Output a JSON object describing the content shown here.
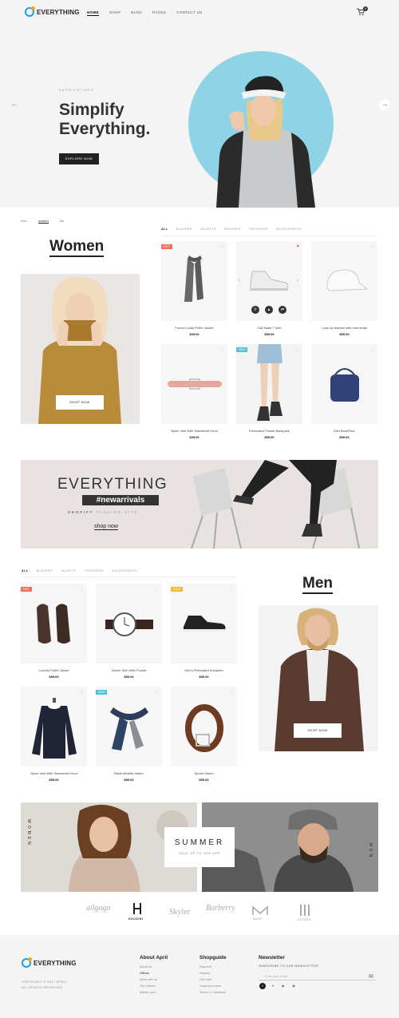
{
  "header": {
    "logo": "EVERYTHING",
    "nav": [
      "HOME",
      "SHOP",
      "BLOG",
      "PAGES",
      "CONTACT US"
    ],
    "cart_count": "0"
  },
  "hero": {
    "tag": "#APRILSTORE",
    "title_line1": "Simplify",
    "title_line2": "Everything.",
    "button": "EXPLORE NOW",
    "categories": [
      "men",
      "women",
      "kid"
    ]
  },
  "women": {
    "title": "Women",
    "shop_button": "SHOP NOW",
    "tabs": [
      "ALL",
      "BLAZERS",
      "JACKETS",
      "DRESSES",
      "TROUSERS",
      "ACCESSORIES"
    ],
    "products": [
      {
        "name": "Funnel Collar Puffer Jacket",
        "price": "$39.00",
        "badge": "HOT"
      },
      {
        "name": "Cali Skate T shirt",
        "price": "$59.00",
        "badge": ""
      },
      {
        "name": "Lace-up trainers with heel detail",
        "price": "$59.00",
        "badge": ""
      },
      {
        "name": "Nylon Vest With Sweatshirt Hood",
        "price": "$39.00",
        "badge": ""
      },
      {
        "name": "Embossed Pocket Backpack",
        "price": "$59.00",
        "badge": "NEW"
      },
      {
        "name": "Mini BackPack",
        "price": "$59.00",
        "badge": ""
      }
    ]
  },
  "banner": {
    "title": "EVERYTHING",
    "tag": "#newarrivals",
    "sub_bold": "SHOPIFY",
    "sub": "FASHION SITE",
    "link": "shop now"
  },
  "men": {
    "title": "Men",
    "shop_button": "SHOP NOW",
    "tabs": [
      "ALL",
      "BLAZERS",
      "JACKETS",
      "TROUSERS",
      "ACCESSORIES"
    ],
    "products": [
      {
        "name": "Colorful Puffer Jacket",
        "price": "$59.00",
        "badge": "HOT"
      },
      {
        "name": "Denim Shirt With Pocket",
        "price": "$59.00",
        "badge": ""
      },
      {
        "name": "Men's Perforated Sneakers",
        "price": "$59.00",
        "badge": "SALE"
      },
      {
        "name": "Nylon Vest With Sweatshirt Hood",
        "price": "$59.00",
        "badge": ""
      },
      {
        "name": "Black Metallic Watch",
        "price": "$59.00",
        "badge": "NEW"
      },
      {
        "name": "Sports Shoes",
        "price": "$59.00",
        "badge": ""
      }
    ]
  },
  "summer": {
    "title": "SUMMER",
    "sub": "SALE UP TO 30% OFF",
    "left_label": "WOMEN",
    "right_label": "MEN"
  },
  "brands": [
    "allgogo",
    "HOUDINI",
    "Skyler",
    "Barberry",
    "MADE",
    "CATMEN"
  ],
  "footer": {
    "logo": "EVERYTHING",
    "copyright": "COPYRIGHT © 2017 APRIL.",
    "rights": "ALL RIGHTS RESERVED",
    "col1_title": "About April",
    "col1_links": [
      "About us",
      "Offices",
      "Work with us",
      "Our policies",
      "Affinity card"
    ],
    "col2_title": "Shopguide",
    "col2_links": [
      "Payment",
      "Returns",
      "Gift Card",
      "Guest purchase",
      "Terms & Conditions"
    ],
    "newsletter_title": "Newsletter",
    "newsletter_sub": "SUBSCRIBE TO OUR NEWSLETTER",
    "newsletter_placeholder": "Enter your email"
  },
  "colors": {
    "accent": "#8ed3e6",
    "badge_hot": "#f06f5d",
    "badge_new": "#56c0d8",
    "badge_sale": "#f4b63f"
  }
}
